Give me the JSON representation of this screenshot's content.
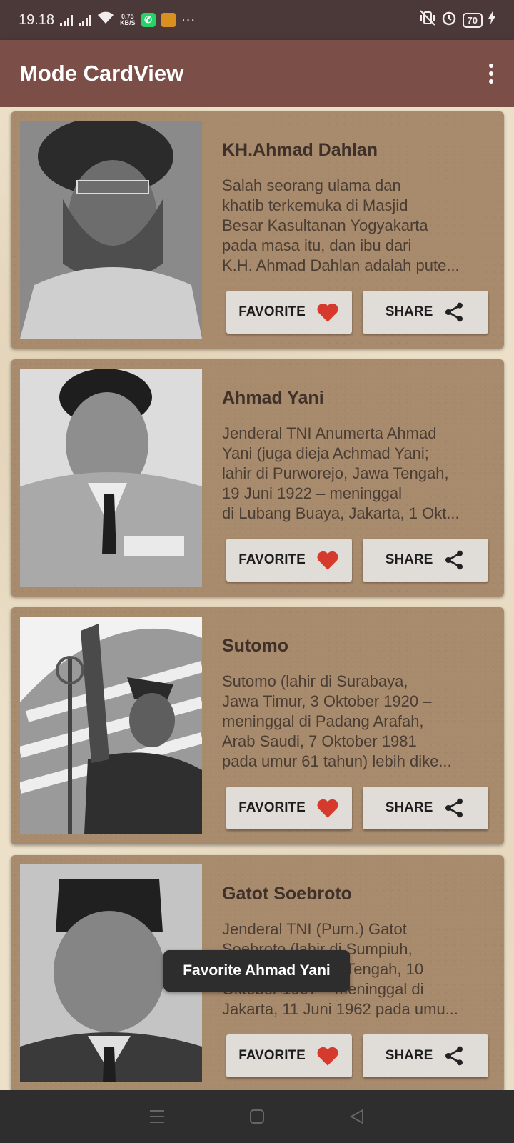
{
  "status_bar": {
    "time": "19.18",
    "net_speed_value": "0.75",
    "net_speed_unit": "KB/S",
    "whatsapp_glyph": "✆",
    "more_dots": "···",
    "battery": "70",
    "icons": [
      "signal-icon",
      "signal-icon",
      "wifi-icon",
      "whatsapp-icon",
      "game-icon",
      "vibrate-icon",
      "alarm-icon",
      "battery-icon",
      "charging-icon"
    ]
  },
  "app_bar": {
    "title": "Mode CardView",
    "menu_icon": "overflow-menu-icon"
  },
  "cards": [
    {
      "name": "KH.Ahmad Dahlan",
      "description_lines": [
        "Salah seorang ulama dan",
        "khatib terkemuka di Masjid",
        "Besar Kasultanan Yogyakarta",
        "pada masa itu, dan ibu dari",
        "K.H. Ahmad Dahlan adalah pute..."
      ],
      "favorite_label": "FAVORITE",
      "share_label": "SHARE"
    },
    {
      "name": "Ahmad Yani",
      "description_lines": [
        "Jenderal TNI Anumerta Ahmad",
        "Yani (juga dieja Achmad Yani;",
        "lahir di Purworejo, Jawa Tengah,",
        "19 Juni 1922 – meninggal",
        "di Lubang Buaya, Jakarta, 1 Okt..."
      ],
      "favorite_label": "FAVORITE",
      "share_label": "SHARE"
    },
    {
      "name": "Sutomo",
      "description_lines": [
        "Sutomo (lahir di Surabaya,",
        "Jawa Timur, 3 Oktober 1920 –",
        "meninggal di Padang Arafah,",
        "Arab Saudi, 7 Oktober 1981",
        "pada umur 61 tahun) lebih dike..."
      ],
      "favorite_label": "FAVORITE",
      "share_label": "SHARE"
    },
    {
      "name": "Gatot Soebroto",
      "description_lines": [
        "Jenderal TNI (Purn.) Gatot",
        "Soebroto (lahir di Sumpiuh,",
        "Banyumas, Jawa Tengah, 10",
        "Oktober 1907 – meninggal di",
        "Jakarta, 11 Juni 1962 pada umu..."
      ],
      "favorite_label": "FAVORITE",
      "share_label": "SHARE"
    }
  ],
  "toast": {
    "text": "Favorite Ahmad Yani"
  },
  "colors": {
    "app_bar": "#7b4f48",
    "status_bar": "#4a3938",
    "card": "#a88a6c",
    "heart": "#d63a2c",
    "button": "#e0dcd8"
  }
}
